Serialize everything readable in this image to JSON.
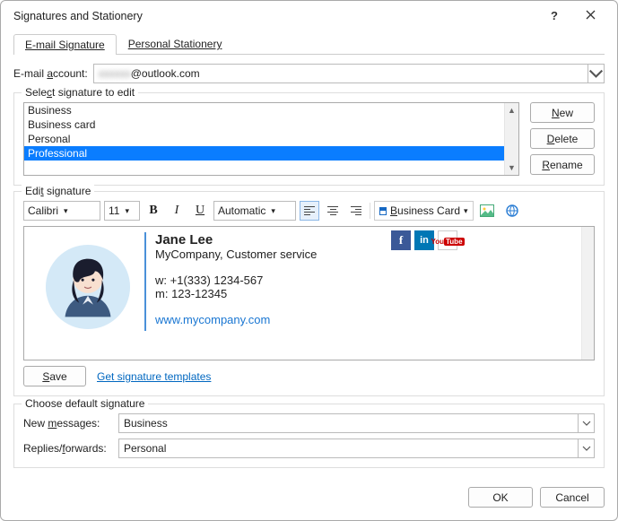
{
  "window": {
    "title": "Signatures and Stationery"
  },
  "tabs": {
    "email": "E-mail Signature",
    "stationery": "Personal Stationery"
  },
  "account": {
    "label_pre": "E-mail ",
    "label_u": "a",
    "label_post": "ccount:",
    "value_suffix": "@outlook.com",
    "value_prefix_hidden": "xxxxxx"
  },
  "select_sig": {
    "legend_pre": "Sele",
    "legend_u": "c",
    "legend_post": "t signature to edit",
    "items": [
      "Business",
      "Business card",
      "Personal",
      "Professional"
    ],
    "selected_index": 3
  },
  "sig_buttons": {
    "new_u": "N",
    "new_rest": "ew",
    "delete_u": "D",
    "delete_rest": "elete",
    "rename_u": "R",
    "rename_rest": "ename"
  },
  "edit": {
    "legend_pre": "Edi",
    "legend_u": "t",
    "legend_post": " signature",
    "font": "Calibri",
    "size": "11",
    "color": "Automatic",
    "card_pre": "",
    "card_u": "B",
    "card_post": "usiness Card"
  },
  "preview": {
    "name": "Jane Lee",
    "company": "MyCompany, Customer service",
    "work_lbl": "w: ",
    "work_phone": "+1(333) 1234-567",
    "mob_lbl": "m: ",
    "mob_phone": "123-12345",
    "website": "www.mycompany.com"
  },
  "below": {
    "save_u": "S",
    "save_rest": "ave",
    "templates": "Get signature templates"
  },
  "defaults": {
    "legend": "Choose default signature",
    "newmsg_pre": "New ",
    "newmsg_u": "m",
    "newmsg_post": "essages:",
    "replies_pre": "Replies/",
    "replies_u": "f",
    "replies_post": "orwards:",
    "newmsg_value": "Business",
    "replies_value": "Personal"
  },
  "footer": {
    "ok": "OK",
    "cancel": "Cancel"
  }
}
